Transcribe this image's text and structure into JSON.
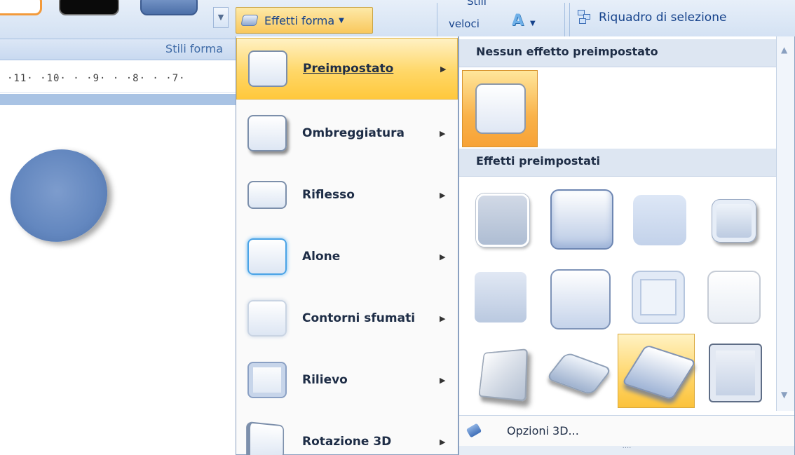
{
  "ribbon": {
    "effects_button_label": "Effetti forma",
    "quick_styles_label_line1": "Stili",
    "quick_styles_label_line2": "veloci",
    "word_art_letter": "A",
    "selection_pane_label": "Riquadro di selezione",
    "gallery_more_icon": "scroll-down-icon",
    "colors": {
      "accent": "#f9c85d",
      "ribbon_bg": "#d3e1f3",
      "text": "#15428b"
    }
  },
  "group_bar": {
    "label": "Stili forma"
  },
  "ruler": {
    "text": "·11· ·10· · ·9· · ·8· · ·7·"
  },
  "menu": {
    "items": [
      {
        "label": "Preimpostato",
        "hotkey_index": 0,
        "active": true
      },
      {
        "label": "Ombreggiatura"
      },
      {
        "label": "Riflesso"
      },
      {
        "label": "Alone"
      },
      {
        "label": "Contorni sfumati"
      },
      {
        "label": "Rilievo"
      },
      {
        "label": "Rotazione 3D"
      }
    ],
    "arrow_glyph": "▶"
  },
  "submenu": {
    "section_none": "Nessun effetto preimpostato",
    "section_presets": "Effetti preimpostati",
    "options_label": "Opzioni 3D...",
    "grip": "····"
  }
}
